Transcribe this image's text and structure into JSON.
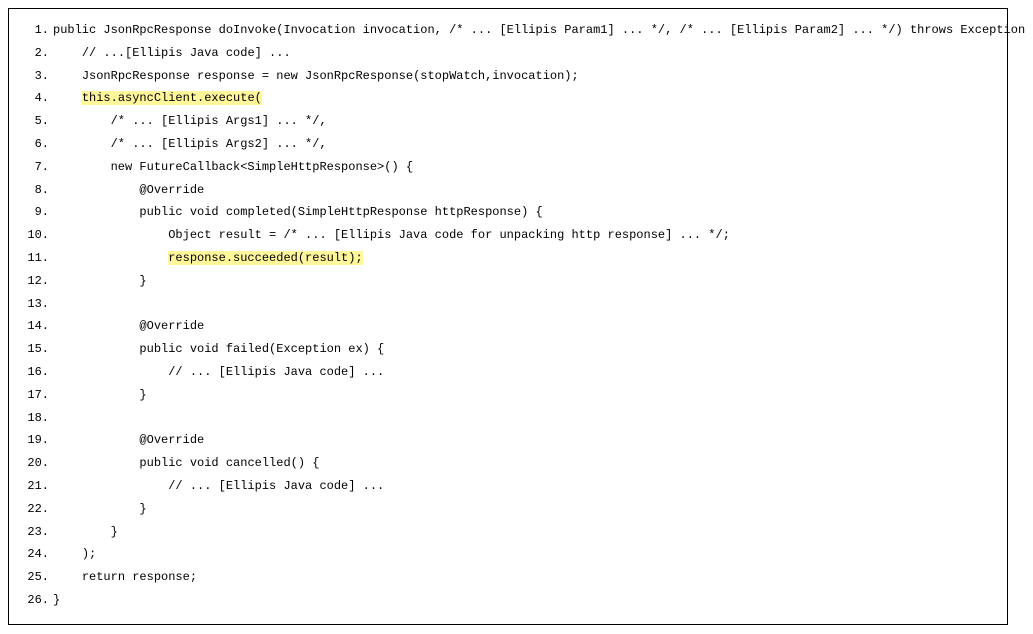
{
  "code": {
    "lines": [
      {
        "num": "1.",
        "indent": "",
        "pre": "public JsonRpcResponse doInvoke(Invocation invocation, /* ... [Ellipis Param1] ... */, /* ... [Ellipis Param2] ... */) throws Exception {",
        "hl": "",
        "post": ""
      },
      {
        "num": "2.",
        "indent": "    ",
        "pre": "// ...[Ellipis Java code] ...",
        "hl": "",
        "post": ""
      },
      {
        "num": "3.",
        "indent": "    ",
        "pre": "JsonRpcResponse response = new JsonRpcResponse(stopWatch,invocation);",
        "hl": "",
        "post": ""
      },
      {
        "num": "4.",
        "indent": "    ",
        "pre": "",
        "hl": "this.asyncClient.execute(",
        "post": ""
      },
      {
        "num": "5.",
        "indent": "        ",
        "pre": "/* ... [Ellipis Args1] ... */,",
        "hl": "",
        "post": ""
      },
      {
        "num": "6.",
        "indent": "        ",
        "pre": "/* ... [Ellipis Args2] ... */,",
        "hl": "",
        "post": ""
      },
      {
        "num": "7.",
        "indent": "        ",
        "pre": "new FutureCallback<SimpleHttpResponse>() {",
        "hl": "",
        "post": ""
      },
      {
        "num": "8.",
        "indent": "            ",
        "pre": "@Override",
        "hl": "",
        "post": ""
      },
      {
        "num": "9.",
        "indent": "            ",
        "pre": "public void completed(SimpleHttpResponse httpResponse) {",
        "hl": "",
        "post": ""
      },
      {
        "num": "10.",
        "indent": "                ",
        "pre": "Object result = /* ... [Ellipis Java code for unpacking http response] ... */;",
        "hl": "",
        "post": ""
      },
      {
        "num": "11.",
        "indent": "                ",
        "pre": "",
        "hl": "response.succeeded(result);",
        "post": ""
      },
      {
        "num": "12.",
        "indent": "            ",
        "pre": "}",
        "hl": "",
        "post": ""
      },
      {
        "num": "13.",
        "indent": "",
        "pre": "",
        "hl": "",
        "post": ""
      },
      {
        "num": "14.",
        "indent": "            ",
        "pre": "@Override",
        "hl": "",
        "post": ""
      },
      {
        "num": "15.",
        "indent": "            ",
        "pre": "public void failed(Exception ex) {",
        "hl": "",
        "post": ""
      },
      {
        "num": "16.",
        "indent": "                ",
        "pre": "// ... [Ellipis Java code] ...",
        "hl": "",
        "post": ""
      },
      {
        "num": "17.",
        "indent": "            ",
        "pre": "}",
        "hl": "",
        "post": ""
      },
      {
        "num": "18.",
        "indent": "",
        "pre": "",
        "hl": "",
        "post": ""
      },
      {
        "num": "19.",
        "indent": "            ",
        "pre": "@Override",
        "hl": "",
        "post": ""
      },
      {
        "num": "20.",
        "indent": "            ",
        "pre": "public void cancelled() {",
        "hl": "",
        "post": ""
      },
      {
        "num": "21.",
        "indent": "                ",
        "pre": "// ... [Ellipis Java code] ...",
        "hl": "",
        "post": ""
      },
      {
        "num": "22.",
        "indent": "            ",
        "pre": "}",
        "hl": "",
        "post": ""
      },
      {
        "num": "23.",
        "indent": "        ",
        "pre": "}",
        "hl": "",
        "post": ""
      },
      {
        "num": "24.",
        "indent": "    ",
        "pre": ");",
        "hl": "",
        "post": ""
      },
      {
        "num": "25.",
        "indent": "    ",
        "pre": "return response;",
        "hl": "",
        "post": ""
      },
      {
        "num": "26.",
        "indent": "",
        "pre": "}",
        "hl": "",
        "post": ""
      }
    ]
  }
}
